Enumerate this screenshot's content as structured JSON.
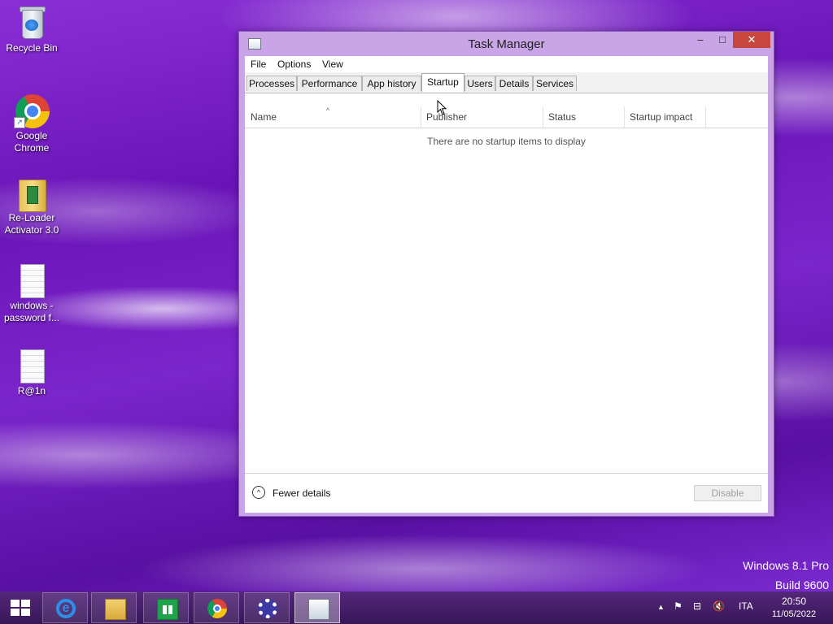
{
  "desktop": {
    "icons": [
      {
        "label": "Recycle Bin"
      },
      {
        "label": "Google Chrome"
      },
      {
        "label": "Re-Loader Activator 3.0"
      },
      {
        "label": "windows - password f..."
      },
      {
        "label": "R@1n"
      }
    ],
    "watermark": {
      "line1": "Windows 8.1 Pro",
      "line2": "Build 9600"
    }
  },
  "window": {
    "title": "Task Manager",
    "controls": {
      "minimize": "–",
      "maximize": "□",
      "close": "✕"
    },
    "menu": [
      "File",
      "Options",
      "View"
    ],
    "tabs": [
      {
        "label": "Processes"
      },
      {
        "label": "Performance"
      },
      {
        "label": "App history"
      },
      {
        "label": "Startup",
        "active": true
      },
      {
        "label": "Users"
      },
      {
        "label": "Details"
      },
      {
        "label": "Services"
      }
    ],
    "columns": [
      "Name",
      "Publisher",
      "Status",
      "Startup impact"
    ],
    "sort_indicator": "^",
    "empty_message": "There are no startup items to display",
    "footer": {
      "fewer_details": "Fewer details",
      "fewer_icon": "^",
      "disable": "Disable"
    }
  },
  "taskbar": {
    "apps": [
      {
        "name": "internet-explorer",
        "icon": "ie-icon",
        "glyph": "e"
      },
      {
        "name": "file-explorer",
        "icon": "folder-icon"
      },
      {
        "name": "store",
        "icon": "store-icon"
      },
      {
        "name": "google-chrome",
        "icon": "chrome-icon"
      },
      {
        "name": "settings",
        "icon": "gear-icon"
      },
      {
        "name": "task-manager",
        "icon": "task-manager-icon",
        "active": true
      }
    ],
    "tray": {
      "show_hidden": "▲",
      "flag": "⚑",
      "network": "⊟",
      "volume": "🔇",
      "language": "ITA",
      "time": "20:50",
      "date": "11/05/2022"
    }
  },
  "colors": {
    "close_button": "#c7463d",
    "window_frame": "#c9a4e6",
    "desktop_accent": "#7b25cc"
  }
}
